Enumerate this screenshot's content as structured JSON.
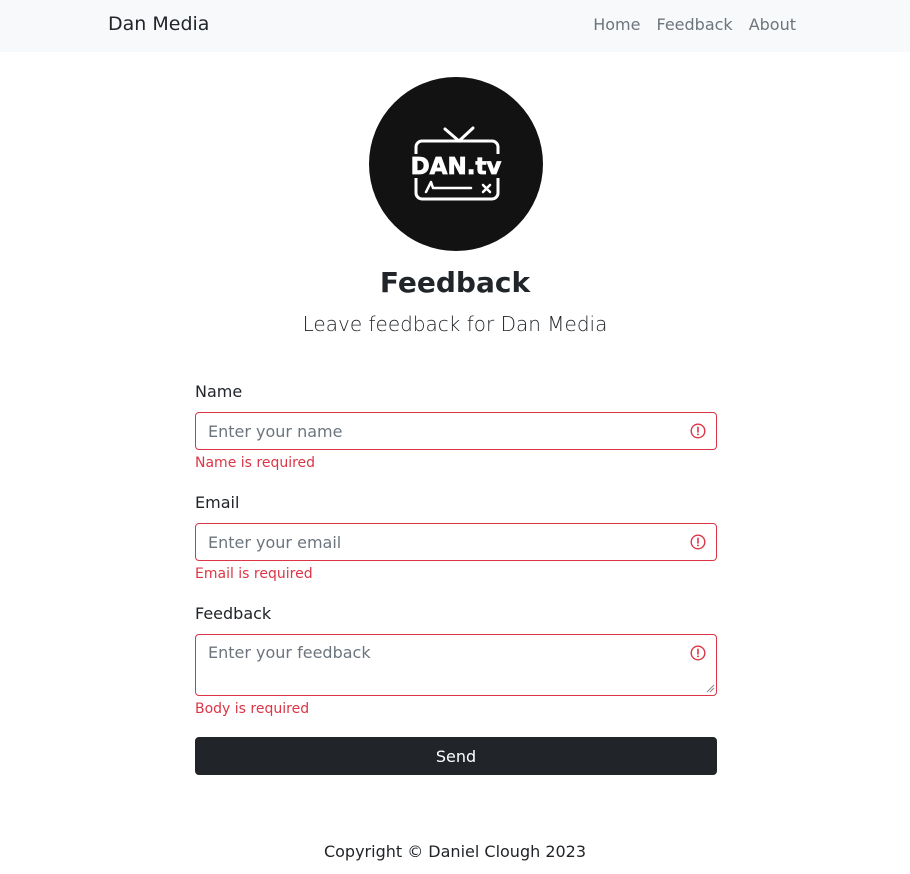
{
  "navbar": {
    "brand": "Dan Media",
    "links": [
      "Home",
      "Feedback",
      "About"
    ]
  },
  "logo": {
    "text": "DAN.tv",
    "icon": "tv-icon"
  },
  "header": {
    "title": "Feedback",
    "subtitle": "Leave feedback for Dan Media"
  },
  "form": {
    "name": {
      "label": "Name",
      "placeholder": "Enter your name",
      "value": "",
      "error": "Name is required"
    },
    "email": {
      "label": "Email",
      "placeholder": "Enter your email",
      "value": "",
      "error": "Email is required"
    },
    "feedback": {
      "label": "Feedback",
      "placeholder": "Enter your feedback",
      "value": "",
      "error": "Body is required"
    },
    "submit_label": "Send"
  },
  "footer": {
    "copyright": "Copyright © Daniel Clough 2023"
  },
  "colors": {
    "navbar_bg": "#f8f9fa",
    "error": "#dc3545",
    "button_bg": "#212529",
    "logo_bg": "#121212"
  }
}
